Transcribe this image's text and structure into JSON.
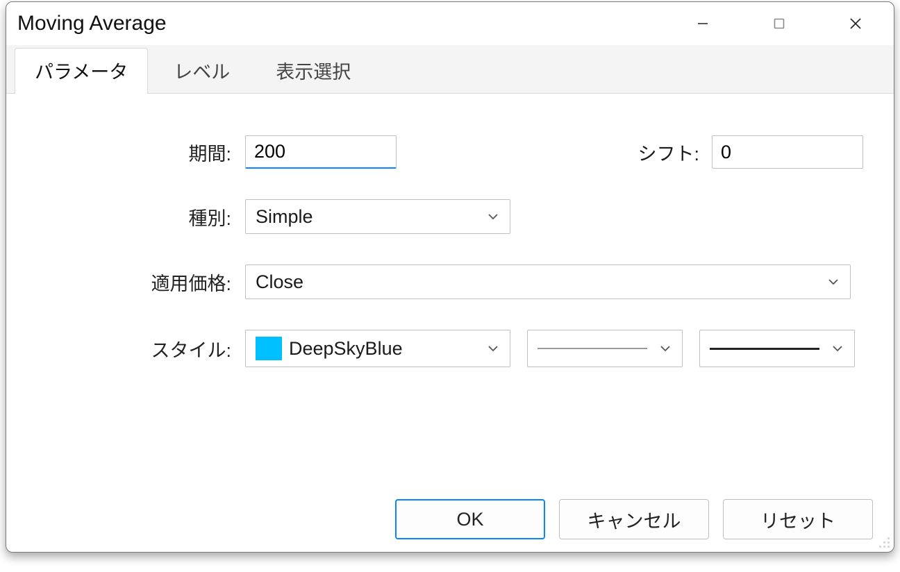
{
  "window": {
    "title": "Moving Average"
  },
  "tabs": [
    {
      "label": "パラメータ",
      "active": true
    },
    {
      "label": "レベル",
      "active": false
    },
    {
      "label": "表示選択",
      "active": false
    }
  ],
  "form": {
    "period": {
      "label": "期間:",
      "value": "200"
    },
    "shift": {
      "label": "シフト:",
      "value": "0"
    },
    "method": {
      "label": "種別:",
      "value": "Simple"
    },
    "apply": {
      "label": "適用価格:",
      "value": "Close"
    },
    "style": {
      "label": "スタイル:",
      "color_name": "DeepSkyBlue",
      "color_hex": "#00bfff"
    }
  },
  "buttons": {
    "ok": "OK",
    "cancel": "キャンセル",
    "reset": "リセット"
  }
}
